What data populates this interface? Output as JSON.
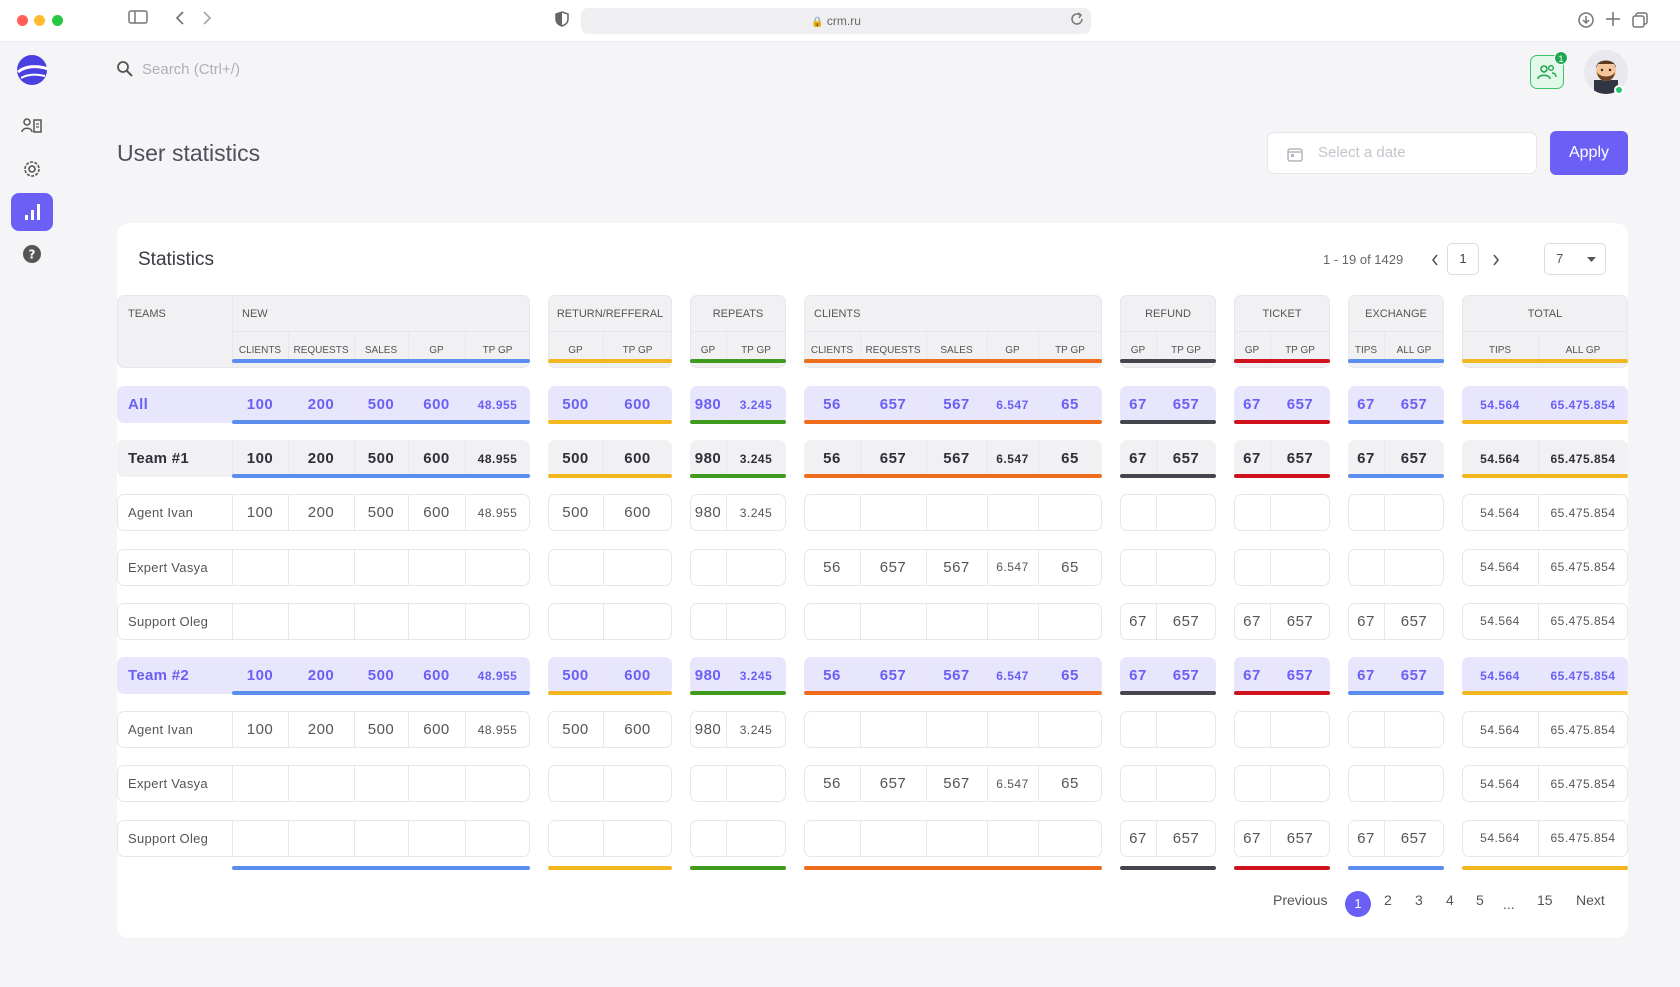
{
  "browser": {
    "url": "crm.ru"
  },
  "search": {
    "placeholder": "Search (Ctrl+/)"
  },
  "header": {
    "notification_count": "1"
  },
  "page": {
    "title": "User statistics",
    "date_placeholder": "Select a date",
    "apply_label": "Apply"
  },
  "stats": {
    "title": "Statistics",
    "range_text": "1 - 19 of 1429",
    "page_input": "1",
    "page_size": "7",
    "groups": [
      {
        "key": "teams",
        "label": "TEAMS",
        "color": "",
        "cols": []
      },
      {
        "key": "new",
        "label": "NEW",
        "color": "#5b8def",
        "cols": [
          "CLIENTS",
          "REQUESTS",
          "SALES",
          "GP",
          "TP GP"
        ]
      },
      {
        "key": "return",
        "label": "RETURN/REFFERAL",
        "color": "#f2b71e",
        "cols": [
          "GP",
          "TP GP"
        ]
      },
      {
        "key": "repeats",
        "label": "REPEATS",
        "color": "#3e9b1e",
        "cols": [
          "GP",
          "TP GP"
        ]
      },
      {
        "key": "clients",
        "label": "CLIENTS",
        "color": "#ee6d1d",
        "cols": [
          "CLIENTS",
          "REQUESTS",
          "SALES",
          "GP",
          "TP GP"
        ]
      },
      {
        "key": "refund",
        "label": "REFUND",
        "color": "#45454d",
        "cols": [
          "GP",
          "TP GP"
        ]
      },
      {
        "key": "ticket",
        "label": "TICKET",
        "color": "#d0121d",
        "cols": [
          "GP",
          "TP GP"
        ]
      },
      {
        "key": "exchange",
        "label": "EXCHANGE",
        "color": "#5b8def",
        "cols": [
          "TIPS",
          "ALL GP"
        ]
      },
      {
        "key": "total",
        "label": "TOTAL",
        "color": "#f2b71e",
        "cols": [
          "TIPS",
          "ALL GP"
        ]
      }
    ],
    "rows": [
      {
        "name": "All",
        "style": "team-hl",
        "values": {
          "new": [
            "100",
            "200",
            "500",
            "600",
            "48.955"
          ],
          "return": [
            "500",
            "600"
          ],
          "repeats": [
            "980",
            "3.245"
          ],
          "clients": [
            "56",
            "657",
            "567",
            "6.547",
            "65"
          ],
          "refund": [
            "67",
            "657"
          ],
          "ticket": [
            "67",
            "657"
          ],
          "exchange": [
            "67",
            "657"
          ],
          "total": [
            "54.564",
            "65.475.854"
          ]
        }
      },
      {
        "name": "Team #1",
        "style": "team-gray",
        "values": {
          "new": [
            "100",
            "200",
            "500",
            "600",
            "48.955"
          ],
          "return": [
            "500",
            "600"
          ],
          "repeats": [
            "980",
            "3.245"
          ],
          "clients": [
            "56",
            "657",
            "567",
            "6.547",
            "65"
          ],
          "refund": [
            "67",
            "657"
          ],
          "ticket": [
            "67",
            "657"
          ],
          "exchange": [
            "67",
            "657"
          ],
          "total": [
            "54.564",
            "65.475.854"
          ]
        }
      },
      {
        "name": "Agent Ivan",
        "style": "plain",
        "values": {
          "new": [
            "100",
            "200",
            "500",
            "600",
            "48.955"
          ],
          "return": [
            "500",
            "600"
          ],
          "repeats": [
            "980",
            "3.245"
          ],
          "clients": [
            "",
            "",
            "",
            "",
            ""
          ],
          "refund": [
            "",
            ""
          ],
          "ticket": [
            "",
            ""
          ],
          "exchange": [
            "",
            ""
          ],
          "total": [
            "54.564",
            "65.475.854"
          ]
        }
      },
      {
        "name": "Expert Vasya",
        "style": "plain",
        "values": {
          "new": [
            "",
            "",
            "",
            "",
            ""
          ],
          "return": [
            "",
            ""
          ],
          "repeats": [
            "",
            ""
          ],
          "clients": [
            "56",
            "657",
            "567",
            "6.547",
            "65"
          ],
          "refund": [
            "",
            ""
          ],
          "ticket": [
            "",
            ""
          ],
          "exchange": [
            "",
            ""
          ],
          "total": [
            "54.564",
            "65.475.854"
          ]
        }
      },
      {
        "name": "Support Oleg",
        "style": "plain",
        "values": {
          "new": [
            "",
            "",
            "",
            "",
            ""
          ],
          "return": [
            "",
            ""
          ],
          "repeats": [
            "",
            ""
          ],
          "clients": [
            "",
            "",
            "",
            "",
            ""
          ],
          "refund": [
            "67",
            "657"
          ],
          "ticket": [
            "67",
            "657"
          ],
          "exchange": [
            "67",
            "657"
          ],
          "total": [
            "54.564",
            "65.475.854"
          ]
        }
      },
      {
        "name": "Team #2",
        "style": "team-hl",
        "values": {
          "new": [
            "100",
            "200",
            "500",
            "600",
            "48.955"
          ],
          "return": [
            "500",
            "600"
          ],
          "repeats": [
            "980",
            "3.245"
          ],
          "clients": [
            "56",
            "657",
            "567",
            "6.547",
            "65"
          ],
          "refund": [
            "67",
            "657"
          ],
          "ticket": [
            "67",
            "657"
          ],
          "exchange": [
            "67",
            "657"
          ],
          "total": [
            "54.564",
            "65.475.854"
          ]
        }
      },
      {
        "name": "Agent Ivan",
        "style": "plain",
        "values": {
          "new": [
            "100",
            "200",
            "500",
            "600",
            "48.955"
          ],
          "return": [
            "500",
            "600"
          ],
          "repeats": [
            "980",
            "3.245"
          ],
          "clients": [
            "",
            "",
            "",
            "",
            ""
          ],
          "refund": [
            "",
            ""
          ],
          "ticket": [
            "",
            ""
          ],
          "exchange": [
            "",
            ""
          ],
          "total": [
            "54.564",
            "65.475.854"
          ]
        }
      },
      {
        "name": "Expert Vasya",
        "style": "plain",
        "values": {
          "new": [
            "",
            "",
            "",
            "",
            ""
          ],
          "return": [
            "",
            ""
          ],
          "repeats": [
            "",
            ""
          ],
          "clients": [
            "56",
            "657",
            "567",
            "6.547",
            "65"
          ],
          "refund": [
            "",
            ""
          ],
          "ticket": [
            "",
            ""
          ],
          "exchange": [
            "",
            ""
          ],
          "total": [
            "54.564",
            "65.475.854"
          ]
        }
      },
      {
        "name": "Support Oleg",
        "style": "plain",
        "values": {
          "new": [
            "",
            "",
            "",
            "",
            ""
          ],
          "return": [
            "",
            ""
          ],
          "repeats": [
            "",
            ""
          ],
          "clients": [
            "",
            "",
            "",
            "",
            ""
          ],
          "refund": [
            "67",
            "657"
          ],
          "ticket": [
            "67",
            "657"
          ],
          "exchange": [
            "67",
            "657"
          ],
          "total": [
            "54.564",
            "65.475.854"
          ]
        }
      }
    ]
  },
  "pagination": {
    "previous": "Previous",
    "pages": [
      "1",
      "2",
      "3",
      "4",
      "5",
      "...",
      "15"
    ],
    "next": "Next"
  },
  "colors": {
    "accent": "#6c5ff5",
    "highlight_bg": "#e8e6fd",
    "gray_bg": "#f1f1f4"
  }
}
